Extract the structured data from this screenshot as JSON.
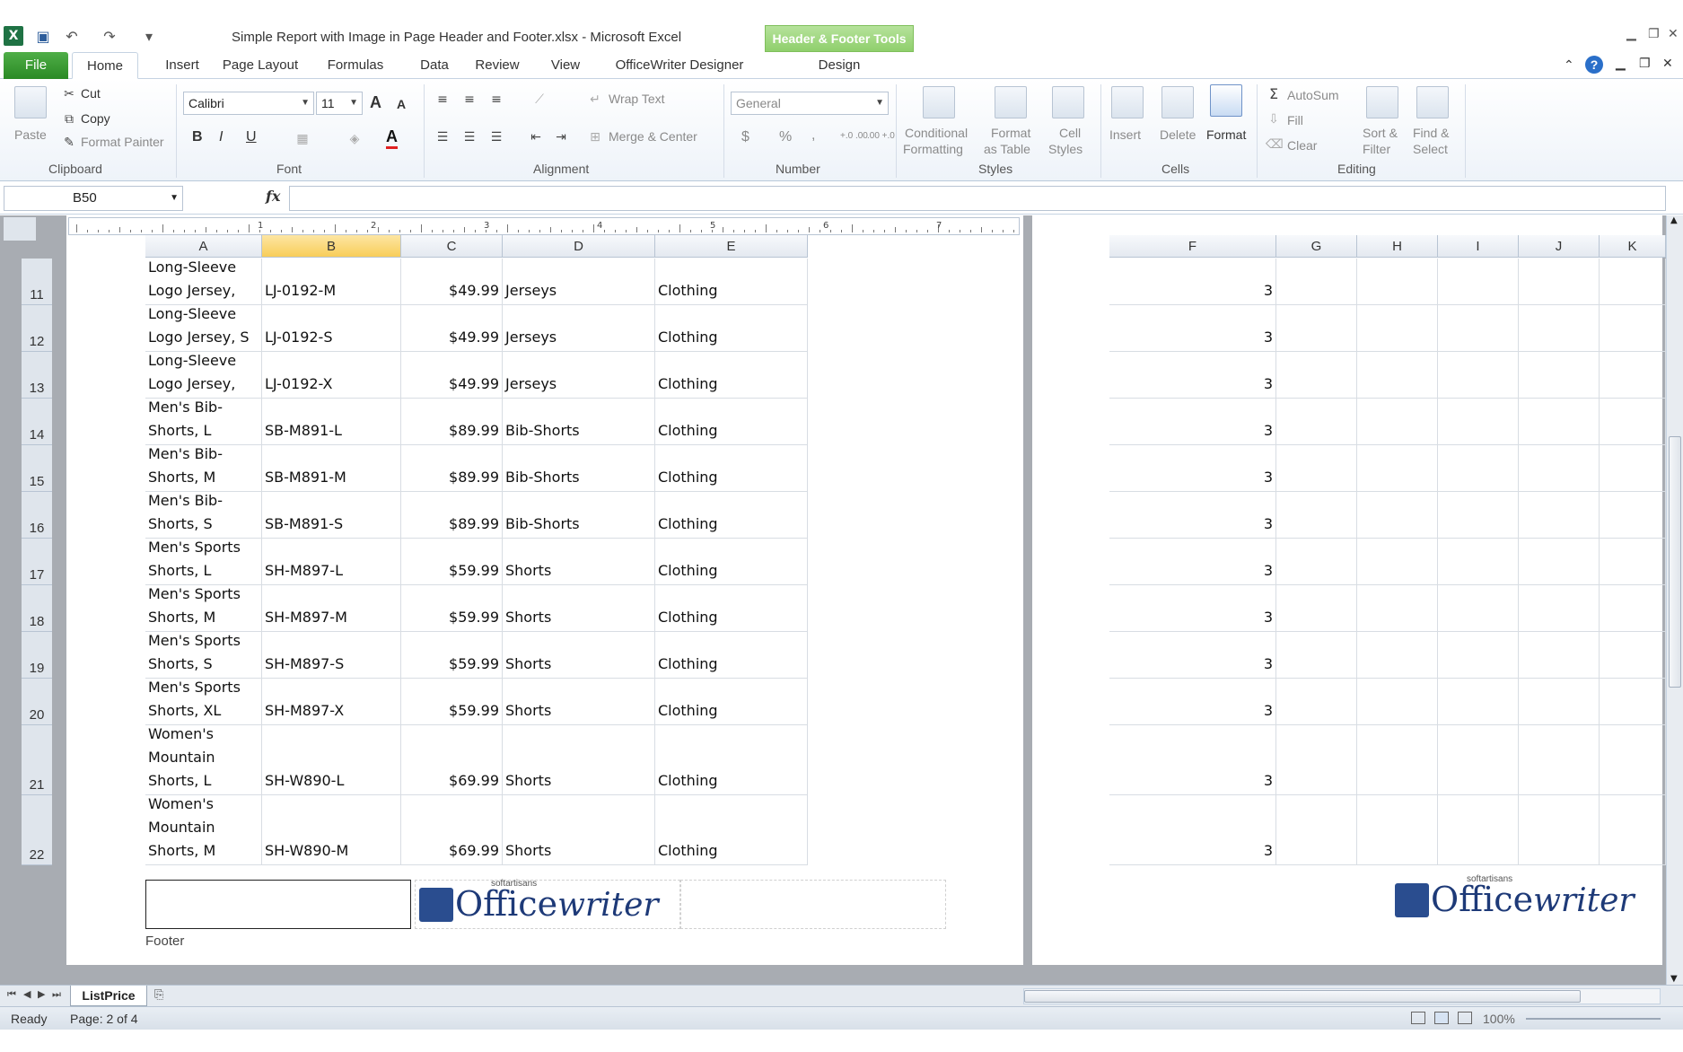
{
  "window": {
    "title": "Simple Report with Image in Page Header and Footer.xlsx  -  Microsoft Excel",
    "contextual_group": "Header & Footer Tools"
  },
  "tabs": [
    "File",
    "Home",
    "Insert",
    "Page Layout",
    "Formulas",
    "Data",
    "Review",
    "View",
    "OfficeWriter Designer",
    "Design"
  ],
  "ribbon": {
    "clipboard": {
      "label": "Clipboard",
      "paste": "Paste",
      "cut": "Cut",
      "copy": "Copy",
      "format_painter": "Format Painter"
    },
    "font": {
      "label": "Font",
      "font_name": "Calibri",
      "font_size": "11",
      "bold": "B",
      "italic": "I",
      "underline": "U",
      "grow": "A",
      "shrink": "A",
      "font_color": "A"
    },
    "alignment": {
      "label": "Alignment",
      "wrap_text": "Wrap Text",
      "merge_center": "Merge & Center"
    },
    "number": {
      "label": "Number",
      "format": "General",
      "currency": "$",
      "percent": "%",
      "comma": ",",
      "inc_dec": "+.0 .00",
      "dec_dec": ".00 +.0"
    },
    "styles": {
      "label": "Styles",
      "conditional": "Conditional",
      "conditional2": "Formatting",
      "format_table": "Format",
      "format_table2": "as Table",
      "cell_styles": "Cell",
      "cell_styles2": "Styles"
    },
    "cells": {
      "label": "Cells",
      "insert": "Insert",
      "delete": "Delete",
      "format": "Format"
    },
    "editing": {
      "label": "Editing",
      "autosum": "AutoSum",
      "fill": "Fill",
      "clear": "Clear",
      "sort": "Sort &",
      "sort2": "Filter",
      "find": "Find &",
      "find2": "Select"
    }
  },
  "formula_bar": {
    "name_box": "B50",
    "fx": "fx",
    "formula": ""
  },
  "columns_left": [
    "A",
    "B",
    "C",
    "D",
    "E"
  ],
  "columns_right": [
    "F",
    "G",
    "H",
    "I",
    "J",
    "K"
  ],
  "selected_column": "B",
  "ruler": [
    "1",
    "2",
    "3",
    "4",
    "5",
    "6",
    "7"
  ],
  "rows": [
    {
      "num": "11",
      "a": "Long-Sleeve Logo Jersey,",
      "b": "LJ-0192-M",
      "c": "$49.99",
      "d": "Jerseys",
      "e": "Clothing",
      "f": "3"
    },
    {
      "num": "12",
      "a": "Long-Sleeve Logo Jersey, S",
      "b": "LJ-0192-S",
      "c": "$49.99",
      "d": "Jerseys",
      "e": "Clothing",
      "f": "3"
    },
    {
      "num": "13",
      "a": "Long-Sleeve Logo Jersey,",
      "b": "LJ-0192-X",
      "c": "$49.99",
      "d": "Jerseys",
      "e": "Clothing",
      "f": "3"
    },
    {
      "num": "14",
      "a": "Men's Bib-Shorts, L",
      "b": "SB-M891-L",
      "c": "$89.99",
      "d": "Bib-Shorts",
      "e": "Clothing",
      "f": "3"
    },
    {
      "num": "15",
      "a": "Men's Bib-Shorts, M",
      "b": "SB-M891-M",
      "c": "$89.99",
      "d": "Bib-Shorts",
      "e": "Clothing",
      "f": "3"
    },
    {
      "num": "16",
      "a": "Men's Bib-Shorts, S",
      "b": "SB-M891-S",
      "c": "$89.99",
      "d": "Bib-Shorts",
      "e": "Clothing",
      "f": "3"
    },
    {
      "num": "17",
      "a": "Men's Sports Shorts, L",
      "b": "SH-M897-L",
      "c": "$59.99",
      "d": "Shorts",
      "e": "Clothing",
      "f": "3"
    },
    {
      "num": "18",
      "a": "Men's Sports Shorts, M",
      "b": "SH-M897-M",
      "c": "$59.99",
      "d": "Shorts",
      "e": "Clothing",
      "f": "3"
    },
    {
      "num": "19",
      "a": "Men's Sports Shorts, S",
      "b": "SH-M897-S",
      "c": "$59.99",
      "d": "Shorts",
      "e": "Clothing",
      "f": "3"
    },
    {
      "num": "20",
      "a": "Men's Sports Shorts, XL",
      "b": "SH-M897-X",
      "c": "$59.99",
      "d": "Shorts",
      "e": "Clothing",
      "f": "3"
    },
    {
      "num": "21",
      "a": "Women's Mountain Shorts, L",
      "b": "SH-W890-L",
      "c": "$69.99",
      "d": "Shorts",
      "e": "Clothing",
      "f": "3"
    },
    {
      "num": "22",
      "a": "Women's Mountain Shorts, M",
      "b": "SH-W890-M",
      "c": "$69.99",
      "d": "Shorts",
      "e": "Clothing",
      "f": "3"
    }
  ],
  "footer": {
    "label": "Footer",
    "logo_text_office": "Office",
    "logo_text_writer": "writer",
    "logo_small": "softartisans"
  },
  "sheet_tabs": [
    "ListPrice"
  ],
  "status": {
    "ready": "Ready",
    "page": "Page: 2 of 4",
    "zoom": "100%"
  },
  "colors": {
    "accent_green": "#2a8a25",
    "hf_tools": "#8fcf6c",
    "selected_col": "#f8cd59",
    "logo": "#1e3a78"
  }
}
